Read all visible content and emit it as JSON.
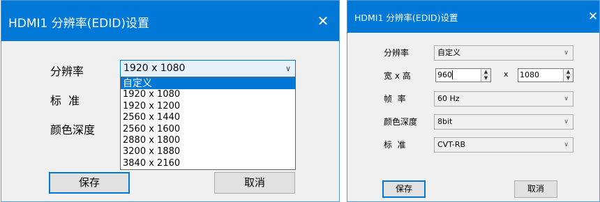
{
  "left_dialog": {
    "title": "HDMI1 分辨率(EDID)设置",
    "close_glyph": "✕",
    "labels": {
      "resolution": "分辨率",
      "standard": "标  准",
      "color_depth": "颜色深度"
    },
    "resolution_select": {
      "value": "1920 x 1080",
      "options": [
        "自定义",
        "1920 x 1080",
        "1920 x 1200",
        "2560 x 1440",
        "2560 x 1600",
        "2880 x 1800",
        "3200 x 1880",
        "3840 x 2160"
      ],
      "highlighted": "自定义"
    },
    "buttons": {
      "save": "保存",
      "cancel": "取消"
    }
  },
  "right_dialog": {
    "title": "HDMI1 分辨率(EDID)设置",
    "close_glyph": "✕",
    "labels": {
      "resolution": "分辨率",
      "width_height": "宽 x 高",
      "frame_rate": "帧  率",
      "color_depth": "颜色深度",
      "standard": "标  准"
    },
    "resolution_value": "自定义",
    "width_value": "960",
    "x_separator": "x",
    "height_value": "1080",
    "frame_rate_value": "60 Hz",
    "color_depth_value": "8bit",
    "standard_value": "CVT-RB",
    "buttons": {
      "save": "保存",
      "cancel": "取消"
    }
  },
  "icons": {
    "dropdown": "chevron-down-icon",
    "spin_up": "caret-up-icon",
    "spin_down": "caret-down-icon"
  },
  "colors": {
    "titlebar": "#0078d7",
    "selection": "#0078d7",
    "dialog_bg": "#f0f0f0"
  }
}
